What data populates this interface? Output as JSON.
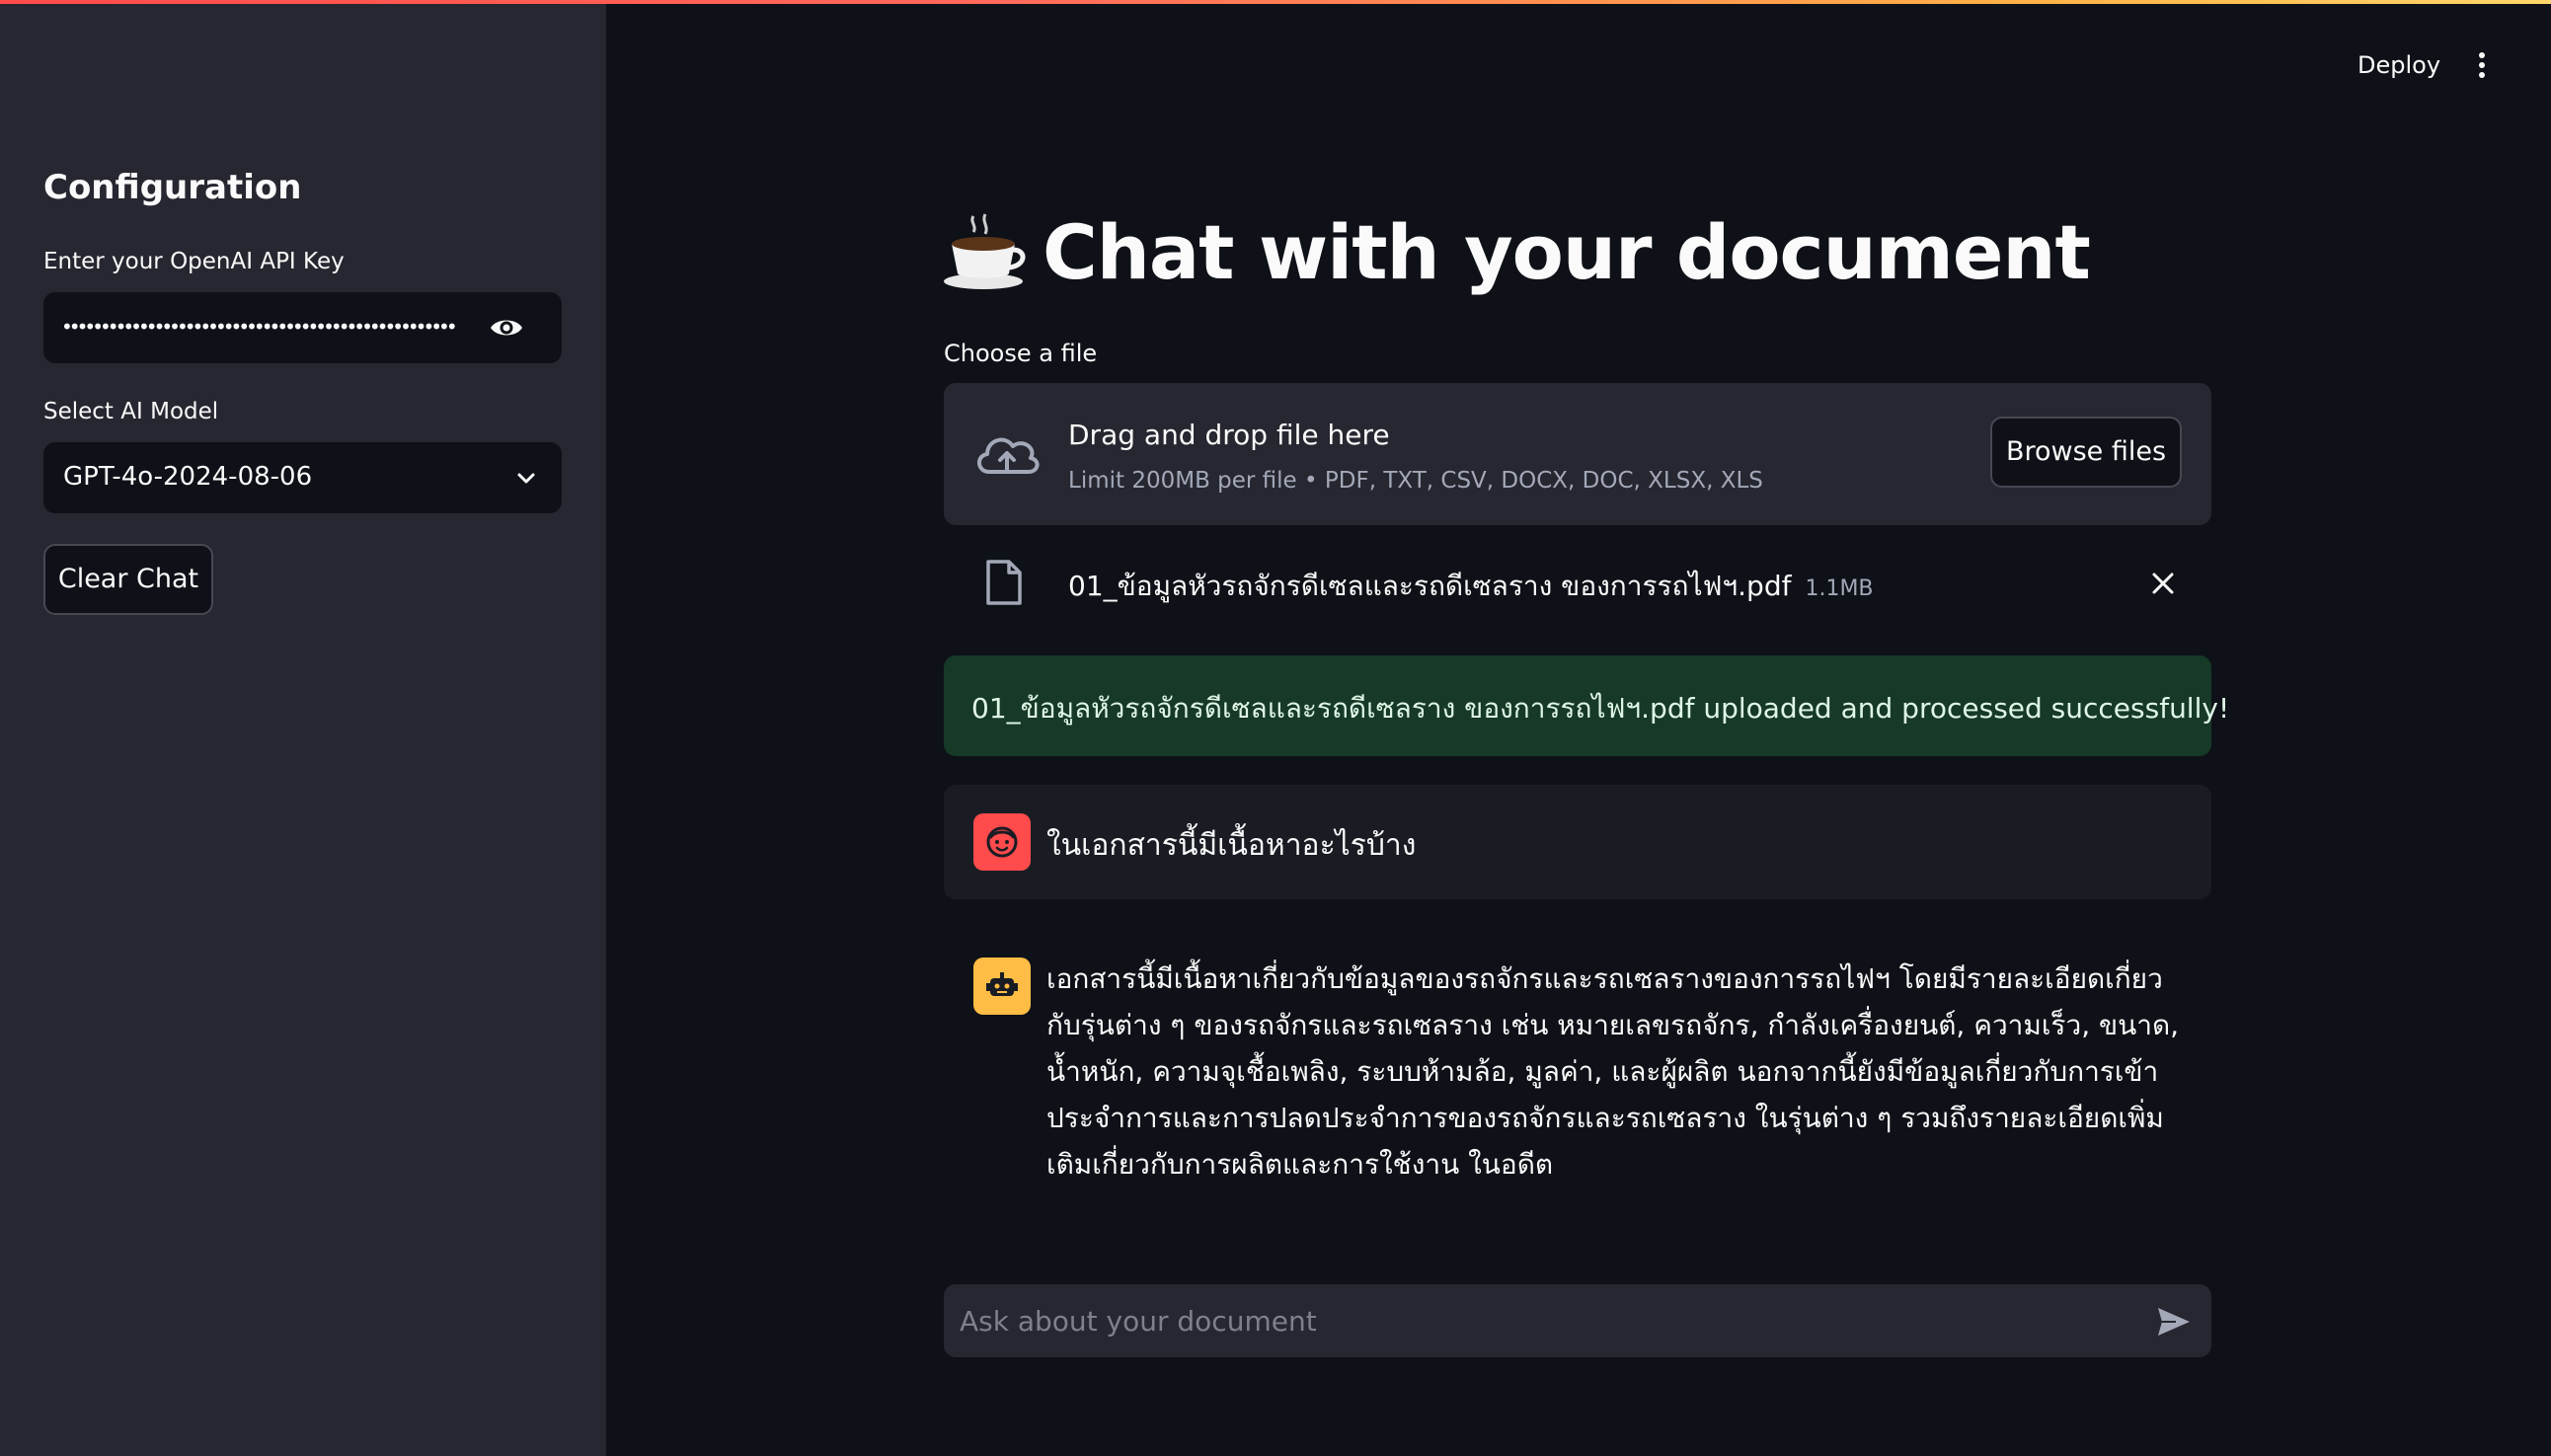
{
  "app": {
    "header": {
      "deploy_label": "Deploy",
      "menu_icon": "kebab-menu-icon"
    }
  },
  "sidebar": {
    "heading": "Configuration",
    "api_key": {
      "label": "Enter your OpenAI API Key",
      "masked_value": "••••••••••••••••••••••••••••••••••••••••••••••••••••••••••••",
      "toggle_icon": "eye-icon"
    },
    "model": {
      "label": "Select AI Model",
      "selected": "GPT-4o-2024-08-06",
      "icon": "chevron-down-icon"
    },
    "clear_chat_label": "Clear Chat"
  },
  "main": {
    "title_icon": "coffee-icon",
    "title": "Chat with your document",
    "uploader": {
      "label": "Choose a file",
      "drop_title": "Drag and drop file here",
      "limit_text": "Limit 200MB per file • PDF, TXT, CSV, DOCX, DOC, XLSX, XLS",
      "browse_label": "Browse files",
      "icon": "cloud-upload-icon"
    },
    "uploaded_file": {
      "name": "01_ข้อมูลหัวรถจักรดีเซลและรถดีเซลราง ของการรถไฟฯ.pdf",
      "size": "1.1MB",
      "icon": "file-icon",
      "remove_icon": "close-icon"
    },
    "success_message": "01_ข้อมูลหัวรถจักรดีเซลและรถดีเซลราง ของการรถไฟฯ.pdf uploaded and processed successfully!",
    "messages": [
      {
        "role": "user",
        "avatar_icon": "user-face-icon",
        "text": "ในเอกสารนี้มีเนื้อหาอะไรบ้าง"
      },
      {
        "role": "assistant",
        "avatar_icon": "robot-icon",
        "text": "เอกสารนี้มีเนื้อหาเกี่ยวกับข้อมูลของรถจักรและรถเซลรางของการรถไฟฯ โดยมีรายละเอียดเกี่ยวกับรุ่นต่าง ๆ ของรถจักรและรถเซลราง เช่น หมายเลขรถจักร, กำลังเครื่องยนต์, ความเร็ว, ขนาด, น้ำหนัก, ความจุเชื้อเพลิง, ระบบห้ามล้อ, มูลค่า, และผู้ผลิต นอกจากนี้ยังมีข้อมูลเกี่ยวกับการเข้าประจำการและการปลดประจำการของรถจักรและรถเซลราง ในรุ่นต่าง ๆ รวมถึงรายละเอียดเพิ่มเติมเกี่ยวกับการผลิตและการใช้งาน ในอดีต"
      }
    ],
    "chat_input": {
      "placeholder": "Ask about your document",
      "value": "",
      "send_icon": "send-icon"
    }
  },
  "colors": {
    "background": "#0e1117",
    "sidebar": "#262730",
    "primary": "#ff4b4b",
    "assistant_avatar": "#ffbd45",
    "success_bg": "#173928"
  }
}
